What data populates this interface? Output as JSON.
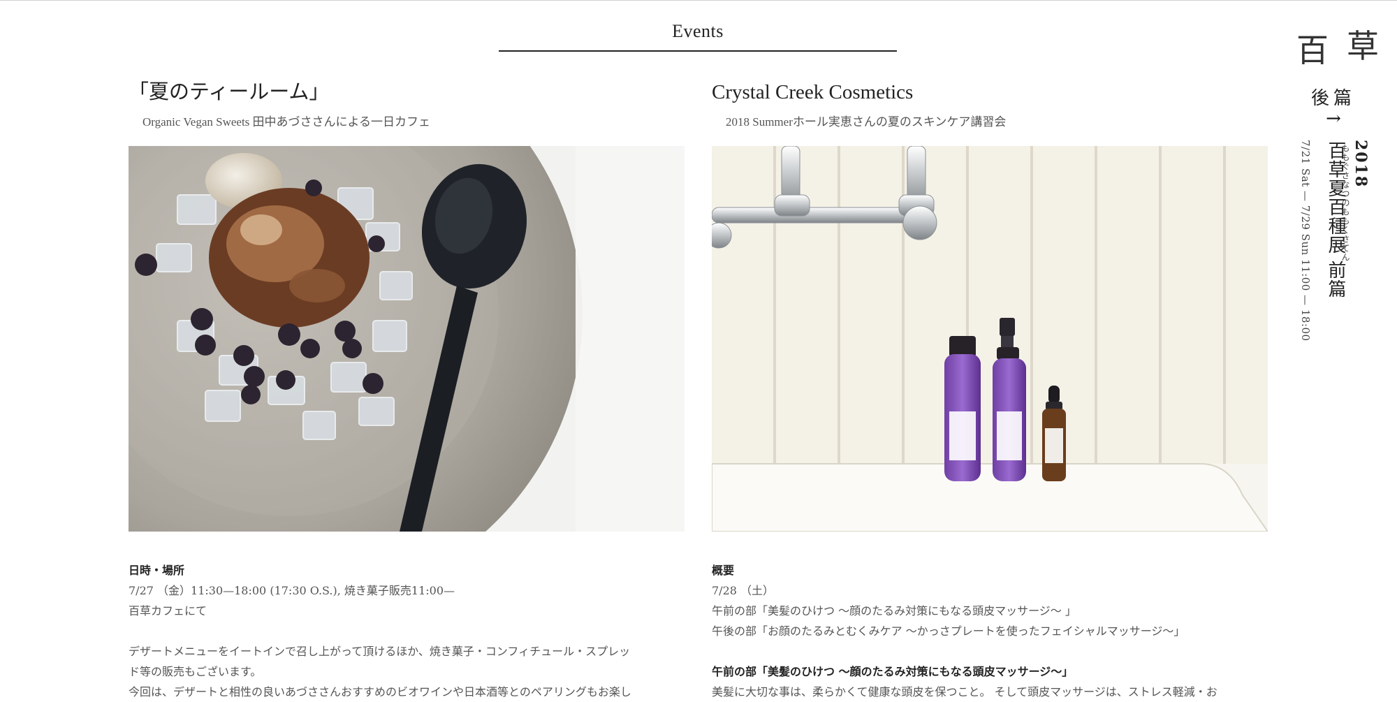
{
  "header": {
    "title": "Events"
  },
  "brand": {
    "char1": "百",
    "char2": "草"
  },
  "part_nav": {
    "label": "後篇",
    "arrow": "→"
  },
  "side_info": {
    "year": "2018",
    "kana": "ももぐさなつのももくさてん",
    "title": "百草夏百種展 前篇",
    "dates": "7/21 Sat — 7/29 Sun 11:00 — 18:00"
  },
  "events": [
    {
      "title": "「夏のティールーム」",
      "subtitle": "Organic Vegan Sweets 田中あづささんによる一日カフェ",
      "photo": "dessert-photo",
      "section_head": "日時・場所",
      "lines": [
        "7/27 （金）11:30—18:00 (17:30 O.S.), 焼き菓子販売11:00—",
        "百草カフェにて"
      ],
      "para_lines": [
        "デザートメニューをイートインで召し上がって頂けるほか、焼き菓子・コンフィチュール・スプレッ",
        "ド等の販売もございます。",
        "今回は、デザートと相性の良いあづささんおすすめのビオワインや日本酒等とのペアリングもお楽し"
      ]
    },
    {
      "title": "Crystal Creek Cosmetics",
      "subtitle": "2018 Summerホール実恵さんの夏のスキンケア講習会",
      "photo": "cosmetics-photo",
      "section_head": "概要",
      "lines": [
        "7/28 （土）",
        "午前の部「美髪のひけつ 〜顔のたるみ対策にもなる頭皮マッサージ〜 」",
        "午後の部「お顔のたるみとむくみケア 〜かっさプレートを使ったフェイシャルマッサージ〜」"
      ],
      "sub_head": "午前の部「美髪のひけつ 〜顔のたるみ対策にもなる頭皮マッサージ〜」",
      "para_lines": [
        "美髪に大切な事は、柔らかくて健康な頭皮を保つこと。 そして頭皮マッサージは、ストレス軽減・お"
      ]
    }
  ],
  "colors": {
    "accent": "#222222",
    "text": "#555555",
    "rule": "#222222"
  }
}
